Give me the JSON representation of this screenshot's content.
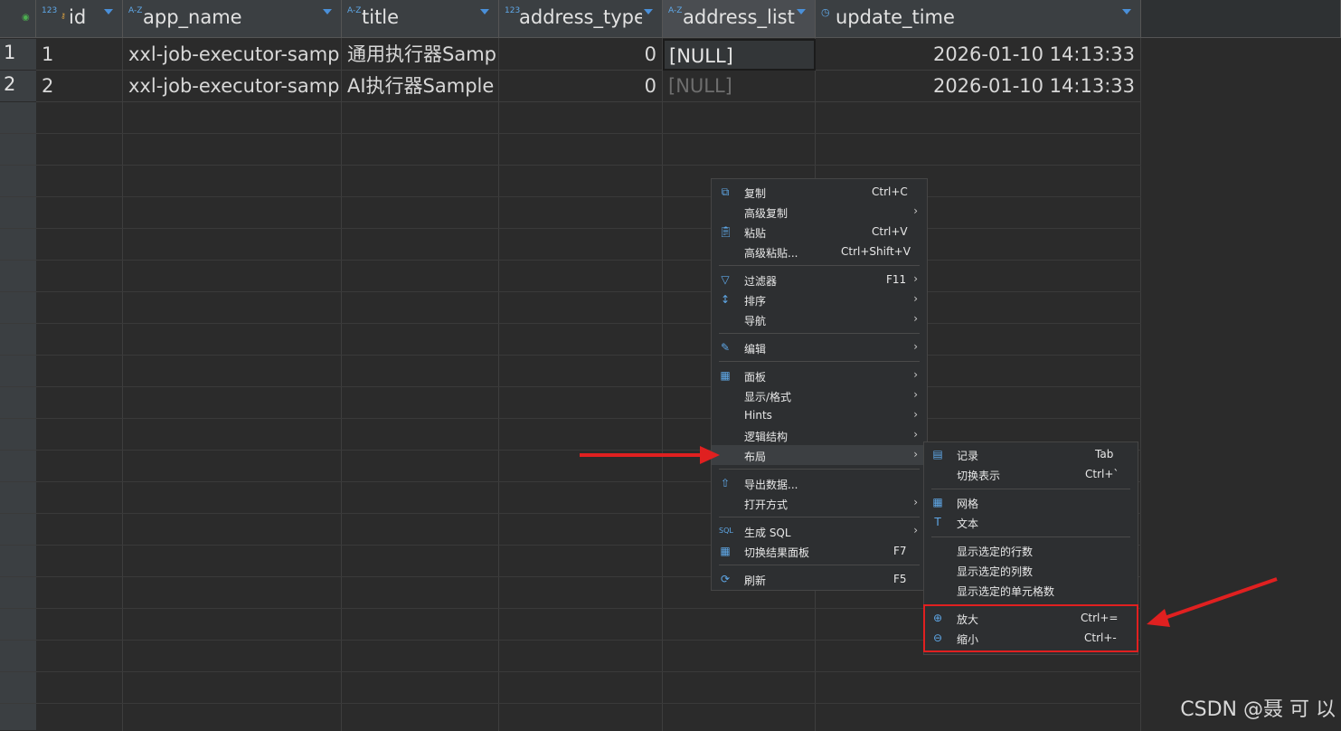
{
  "columns": [
    {
      "type": "123",
      "name": "id",
      "key": true
    },
    {
      "type": "A-Z",
      "name": "app_name"
    },
    {
      "type": "A-Z",
      "name": "title"
    },
    {
      "type": "123",
      "name": "address_type"
    },
    {
      "type": "A-Z",
      "name": "address_list"
    },
    {
      "type": "clock",
      "name": "update_time"
    }
  ],
  "rows": [
    {
      "num": "1",
      "id": "1",
      "app_name": "xxl-job-executor-sampl",
      "title": "通用执行器Samp",
      "address_type": "0",
      "address_list": "[NULL]",
      "update_time": "2026-01-10 14:13:33"
    },
    {
      "num": "2",
      "id": "2",
      "app_name": "xxl-job-executor-sampl",
      "title": "AI执行器Sample",
      "address_type": "0",
      "address_list": "[NULL]",
      "update_time": "2026-01-10 14:13:33"
    }
  ],
  "context_menu": {
    "copy": "复制",
    "copy_sc": "Ctrl+C",
    "adv_copy": "高级复制",
    "paste": "粘贴",
    "paste_sc": "Ctrl+V",
    "adv_paste": "高级粘贴...",
    "adv_paste_sc": "Ctrl+Shift+V",
    "filter": "过滤器",
    "filter_sc": "F11",
    "sort": "排序",
    "nav": "导航",
    "edit": "编辑",
    "panel": "面板",
    "display": "显示/格式",
    "hints": "Hints",
    "logic": "逻辑结构",
    "layout": "布局",
    "export": "导出数据...",
    "open_with": "打开方式",
    "gen_sql": "生成 SQL",
    "toggle_panel": "切换结果面板",
    "toggle_panel_sc": "F7",
    "refresh": "刷新",
    "refresh_sc": "F5"
  },
  "submenu": {
    "record": "记录",
    "record_sc": "Tab",
    "switch": "切换表示",
    "switch_sc": "Ctrl+`",
    "grid": "网格",
    "text": "文本",
    "rows": "显示选定的行数",
    "cols": "显示选定的列数",
    "cells": "显示选定的单元格数",
    "zoom_in": "放大",
    "zoom_in_sc": "Ctrl+=",
    "zoom_out": "缩小",
    "zoom_out_sc": "Ctrl+-"
  },
  "watermark": "CSDN @聂 可 以",
  "colors": {
    "accent": "#5fa8e8",
    "arrow": "#e02020"
  }
}
